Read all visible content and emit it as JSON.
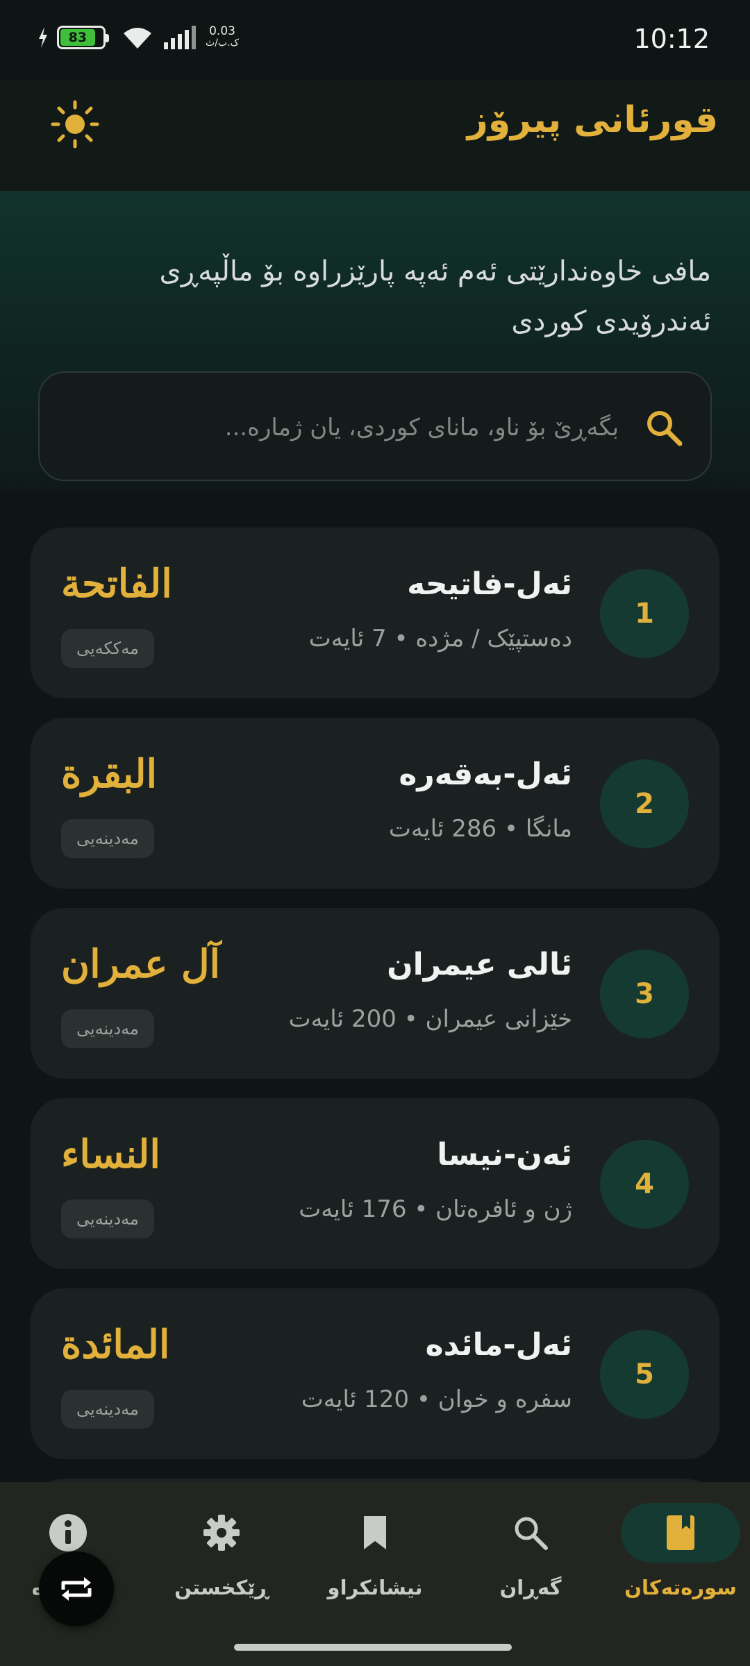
{
  "status_bar": {
    "battery": "83",
    "net_speed_value": "0.03",
    "net_speed_unit": "ک.ب/ث",
    "time": "10:12"
  },
  "app_bar": {
    "title": "قورئانی پیرۆز",
    "theme_icon": "sun-icon"
  },
  "header": {
    "notice": "مافی خاوەندارێتی ئەم ئەپە پارێزراوە بۆ ماڵپەڕی ئەندرۆیدی کوردی",
    "search_placeholder": "بگەڕێ بۆ ناو، مانای کوردی، یان ژمارە..."
  },
  "surahs": [
    {
      "number": "1",
      "name": "ئەل-فاتیحە",
      "meta": "دەستپێک / مژدە • 7 ئایەت",
      "arabic": "الفاتحة",
      "revelation": "مەککەیی"
    },
    {
      "number": "2",
      "name": "ئەل-بەقەرە",
      "meta": "مانگا • 286 ئایەت",
      "arabic": "البقرة",
      "revelation": "مەدینەیی"
    },
    {
      "number": "3",
      "name": "ئالی عیمران",
      "meta": "خێزانی عیمران • 200 ئایەت",
      "arabic": "آل عمران",
      "revelation": "مەدینەیی"
    },
    {
      "number": "4",
      "name": "ئەن-نیسا",
      "meta": "ژن و ئافرەتان • 176 ئایەت",
      "arabic": "النساء",
      "revelation": "مەدینەیی"
    },
    {
      "number": "5",
      "name": "ئەل-مائدە",
      "meta": "سفرە و خوان • 120 ئایەت",
      "arabic": "المائدة",
      "revelation": "مەدینەیی"
    }
  ],
  "bottom_nav": [
    {
      "label": "سورەتەکان",
      "icon": "book-icon",
      "active": true
    },
    {
      "label": "گەڕان",
      "icon": "search-icon",
      "active": false
    },
    {
      "label": "نیشانکراو",
      "icon": "bookmark-icon",
      "active": false
    },
    {
      "label": "ڕێکخستن",
      "icon": "gear-icon",
      "active": false
    },
    {
      "label": "دەربارە",
      "icon": "info-icon",
      "active": false
    }
  ],
  "fab": {
    "icon": "repeat-icon"
  },
  "colors": {
    "accent": "#e2b13b",
    "background": "#0f1514",
    "card": "#1b2120",
    "number_circle": "#153a31",
    "battery": "#3fbf3a"
  }
}
